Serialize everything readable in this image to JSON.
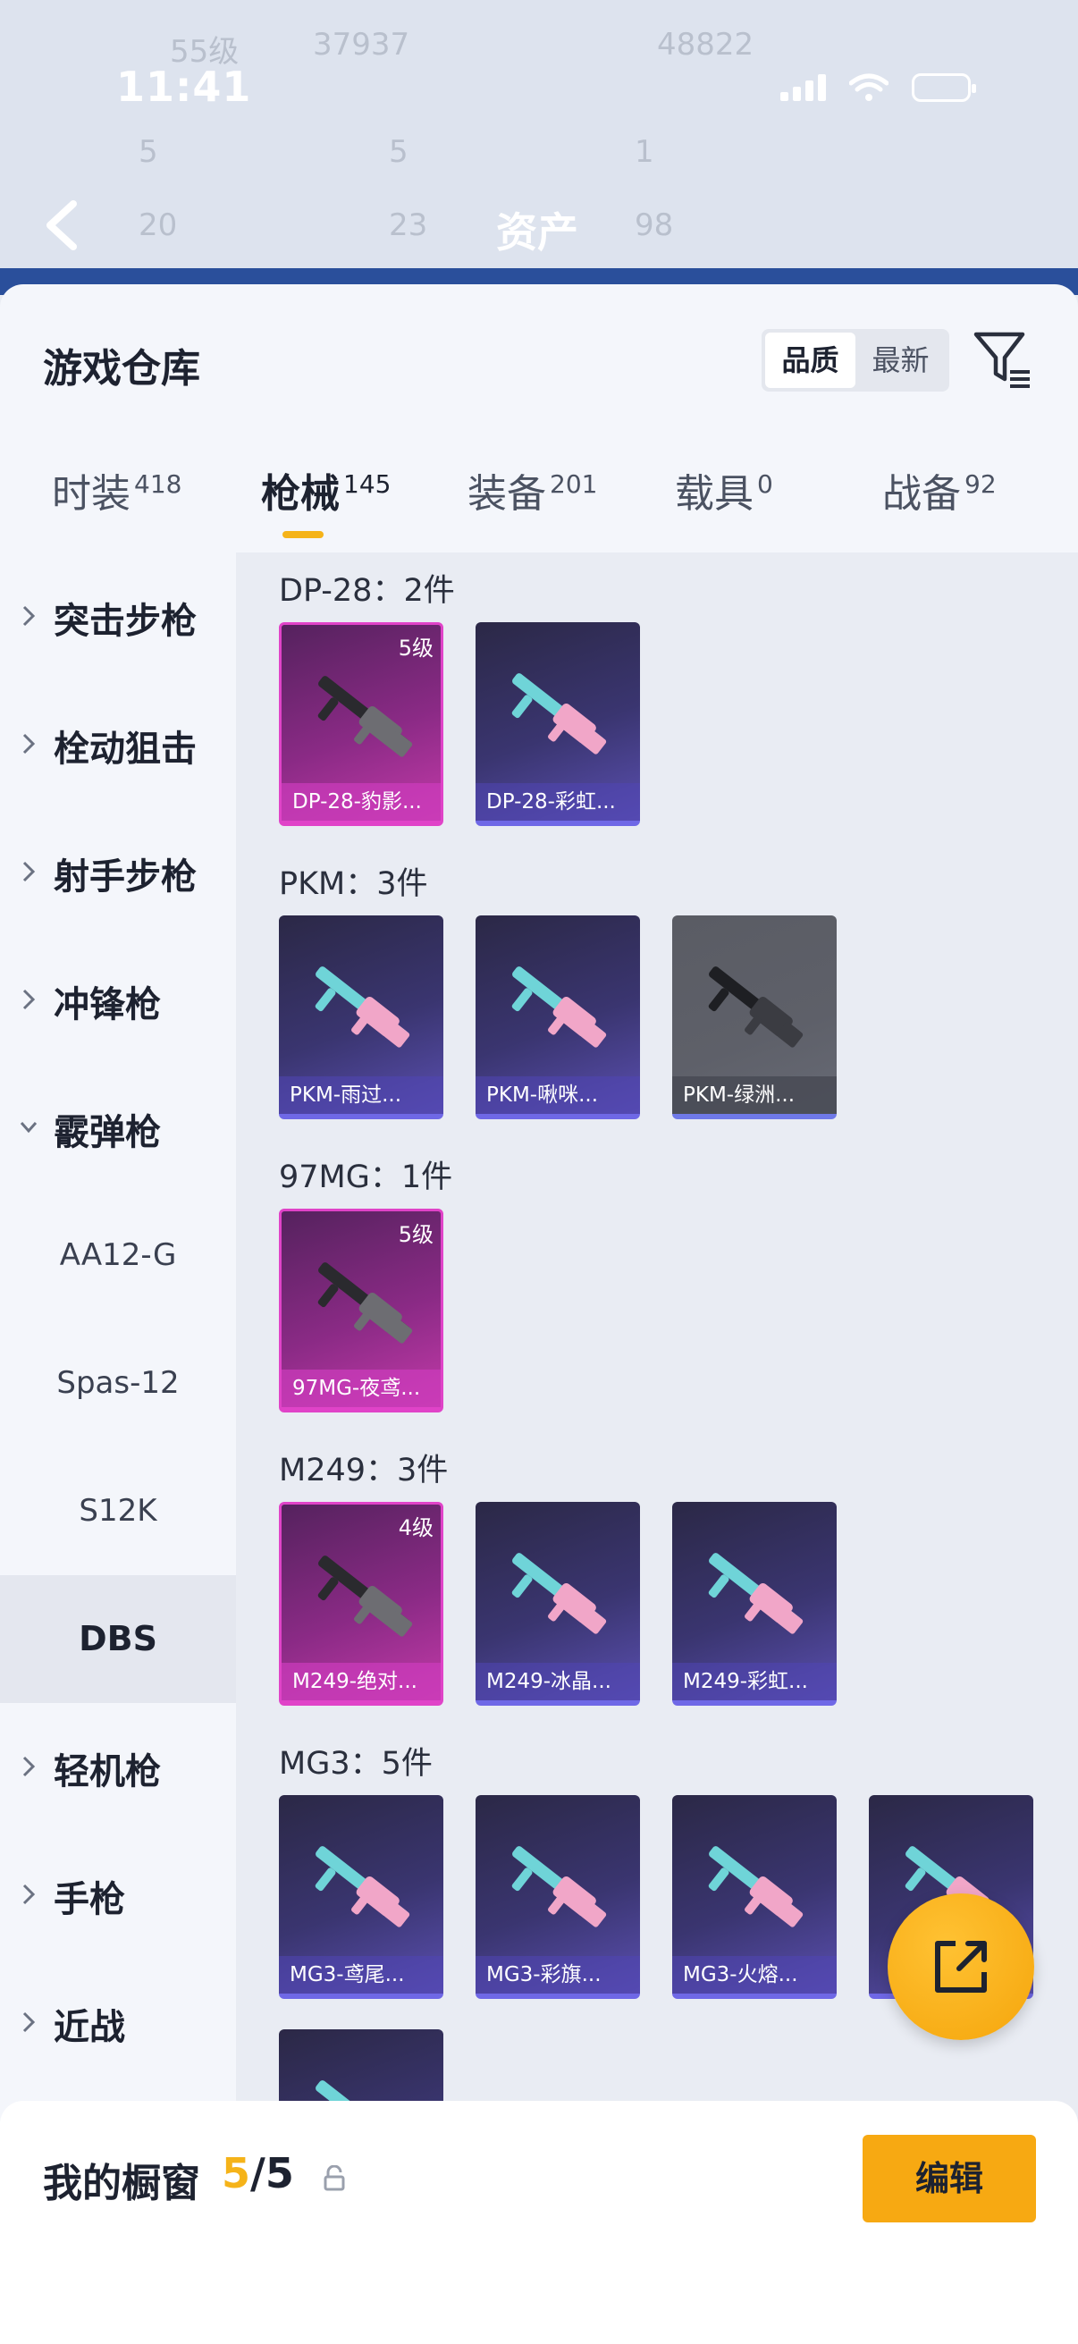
{
  "status": {
    "time": "11:41"
  },
  "nav": {
    "title": "资产"
  },
  "background_rows": {
    "row1": [
      "55级",
      "37937",
      "48822"
    ],
    "row2": [
      "5",
      "5",
      "1"
    ],
    "row3": [
      "20",
      "23",
      "98"
    ]
  },
  "warehouse": {
    "title": "游戏仓库",
    "sort_options": [
      "品质",
      "最新"
    ],
    "sort_active": "品质",
    "tabs": [
      {
        "label": "时装",
        "count": "418"
      },
      {
        "label": "枪械",
        "count": "145"
      },
      {
        "label": "装备",
        "count": "201"
      },
      {
        "label": "载具",
        "count": "0"
      },
      {
        "label": "战备",
        "count": "92"
      }
    ],
    "active_tab": "枪械"
  },
  "sidebar": {
    "items": [
      {
        "label": "突击步枪",
        "expanded": false
      },
      {
        "label": "栓动狙击",
        "expanded": false
      },
      {
        "label": "射手步枪",
        "expanded": false
      },
      {
        "label": "冲锋枪",
        "expanded": false
      },
      {
        "label": "霰弹枪",
        "expanded": true
      },
      {
        "label": "AA12-G",
        "sub": true
      },
      {
        "label": "Spas-12",
        "sub": true
      },
      {
        "label": "S12K",
        "sub": true
      },
      {
        "label": "DBS",
        "sub": true,
        "selected": true
      },
      {
        "label": "轻机枪",
        "expanded": false
      },
      {
        "label": "手枪",
        "expanded": false
      },
      {
        "label": "近战",
        "expanded": false
      }
    ]
  },
  "groups": [
    {
      "title": "DP-28：2件",
      "items": [
        {
          "name": "DP-28-豹影...",
          "level": "5级",
          "rarity": "pink"
        },
        {
          "name": "DP-28-彩虹...",
          "level": "",
          "rarity": "purple"
        }
      ]
    },
    {
      "title": "PKM：3件",
      "items": [
        {
          "name": "PKM-雨过...",
          "level": "",
          "rarity": "purple"
        },
        {
          "name": "PKM-啾咪...",
          "level": "",
          "rarity": "purple"
        },
        {
          "name": "PKM-绿洲...",
          "level": "",
          "rarity": "grey"
        }
      ]
    },
    {
      "title": "97MG：1件",
      "items": [
        {
          "name": "97MG-夜鸢...",
          "level": "5级",
          "rarity": "pink"
        }
      ]
    },
    {
      "title": "M249：3件",
      "items": [
        {
          "name": "M249-绝对...",
          "level": "4级",
          "rarity": "pink"
        },
        {
          "name": "M249-冰晶...",
          "level": "",
          "rarity": "purple"
        },
        {
          "name": "M249-彩虹...",
          "level": "",
          "rarity": "purple"
        }
      ]
    },
    {
      "title": "MG3：5件",
      "items": [
        {
          "name": "MG3-鸢尾...",
          "level": "",
          "rarity": "purple"
        },
        {
          "name": "MG3-彩旗...",
          "level": "",
          "rarity": "purple"
        },
        {
          "name": "MG3-火熔...",
          "level": "",
          "rarity": "purple"
        },
        {
          "name": "",
          "level": "",
          "rarity": "purple"
        },
        {
          "name": "",
          "level": "",
          "rarity": "purple"
        }
      ]
    }
  ],
  "showcase": {
    "title": "我的橱窗",
    "current": "5",
    "total": "/5",
    "edit_label": "编辑"
  },
  "colors": {
    "accent": "#f5b319",
    "pink_rarity": "#e043c8",
    "purple_rarity": "#6f68e6"
  },
  "icons": [
    "back-arrow-icon",
    "filter-icon",
    "chevron-right-icon",
    "chevron-down-icon",
    "lock-icon",
    "share-export-icon"
  ]
}
